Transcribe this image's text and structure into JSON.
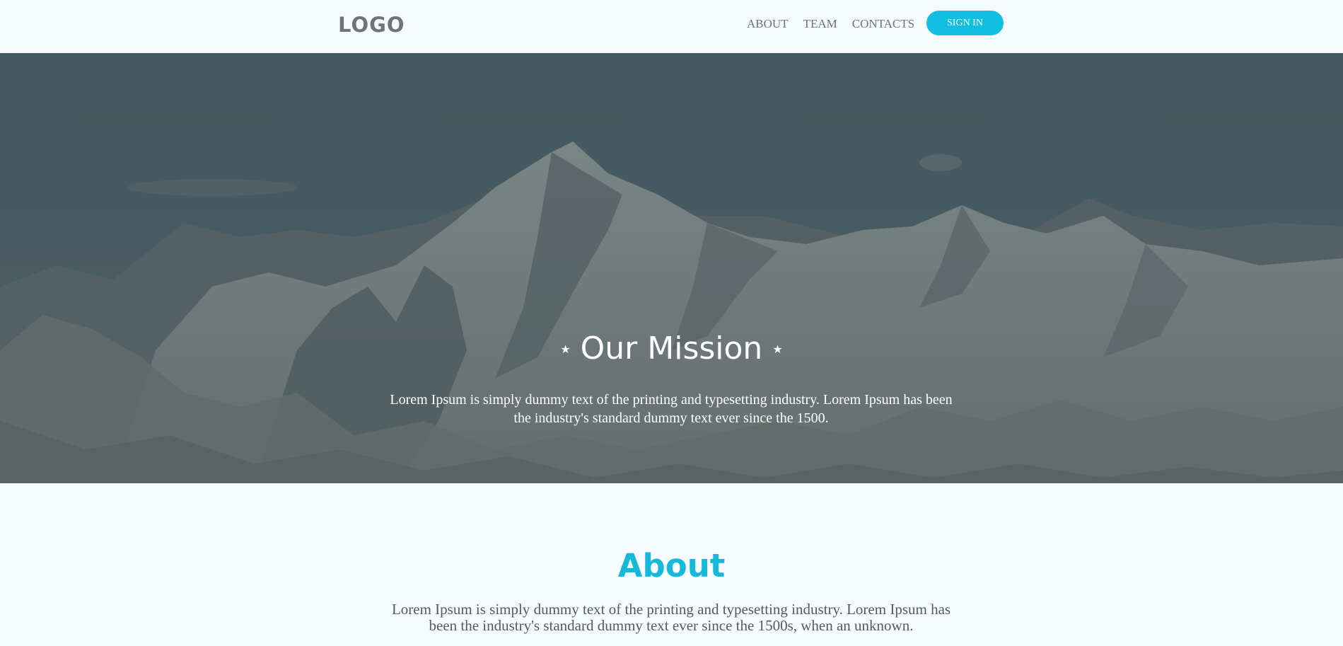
{
  "header": {
    "logo": "LOGO",
    "nav": [
      "ABOUT",
      "TEAM",
      "CONTACTS"
    ],
    "signin_label": "SIGN IN",
    "accent_color": "#12bfe0"
  },
  "hero": {
    "title": "Our Mission",
    "star_icon": "star-icon",
    "text": "Lorem Ipsum is simply dummy text of the printing and typesetting industry. Lorem Ipsum has been the industry's standard dummy text ever since the 1500."
  },
  "about": {
    "title": "About",
    "text": "Lorem Ipsum is simply dummy text of the printing and typesetting industry. Lorem Ipsum has been the industry's standard dummy text ever since the 1500s, when an unknown."
  }
}
